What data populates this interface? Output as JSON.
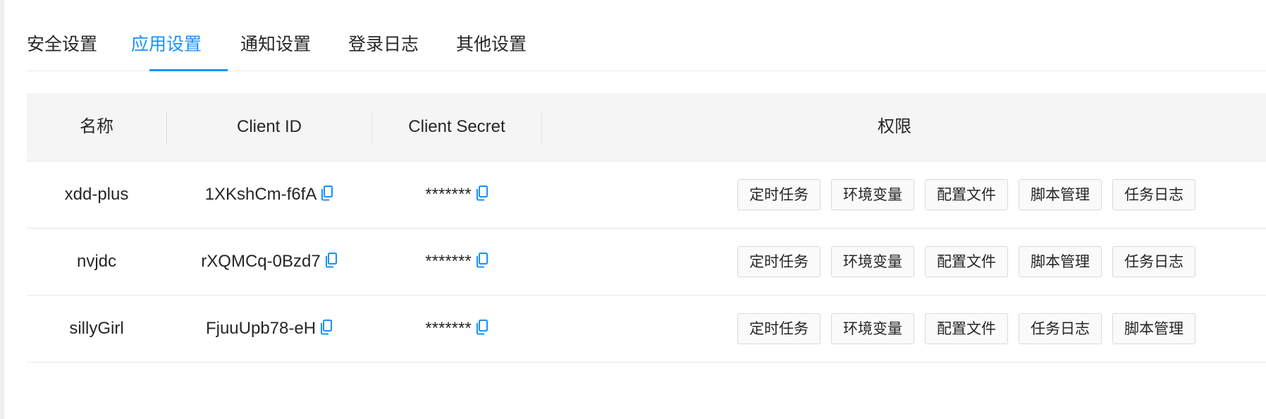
{
  "tabs": [
    {
      "label": "安全设置",
      "active": false
    },
    {
      "label": "应用设置",
      "active": true
    },
    {
      "label": "通知设置",
      "active": false
    },
    {
      "label": "登录日志",
      "active": false
    },
    {
      "label": "其他设置",
      "active": false
    }
  ],
  "table": {
    "columns": [
      "名称",
      "Client ID",
      "Client Secret",
      "权限"
    ],
    "rows": [
      {
        "name": "xdd-plus",
        "client_id": "1XKshCm-f6fA",
        "client_secret": "*******",
        "permissions": [
          "定时任务",
          "环境变量",
          "配置文件",
          "脚本管理",
          "任务日志"
        ]
      },
      {
        "name": "nvjdc",
        "client_id": "rXQMCq-0Bzd7",
        "client_secret": "*******",
        "permissions": [
          "定时任务",
          "环境变量",
          "配置文件",
          "脚本管理",
          "任务日志"
        ]
      },
      {
        "name": "sillyGirl",
        "client_id": "FjuuUpb78-eH",
        "client_secret": "*******",
        "permissions": [
          "定时任务",
          "环境变量",
          "配置文件",
          "任务日志",
          "脚本管理"
        ]
      }
    ]
  },
  "icons": {
    "copy": "copy-icon"
  },
  "colors": {
    "accent": "#1890ff",
    "header_bg": "#f5f5f5",
    "border": "#e8e8e8"
  }
}
